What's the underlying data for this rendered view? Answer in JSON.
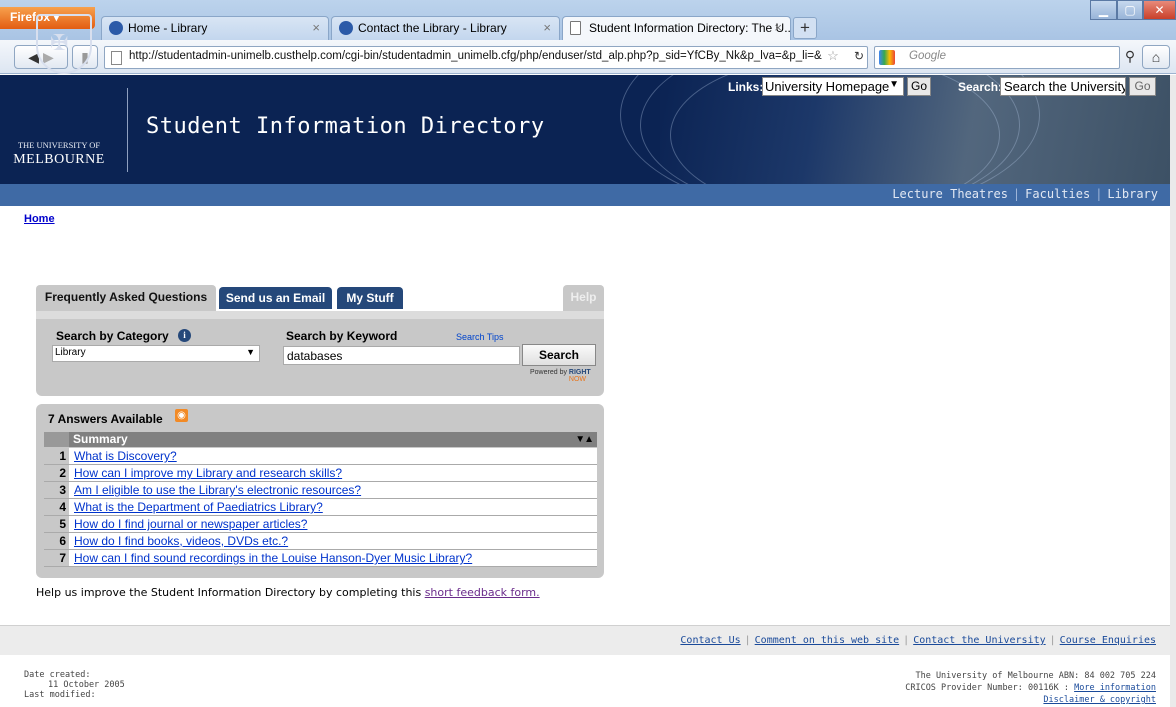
{
  "browser": {
    "menu_button": "Firefox",
    "tabs": [
      {
        "label": "Home - Library"
      },
      {
        "label": "Contact the Library - Library"
      },
      {
        "label": "Student Information Directory: The U..."
      }
    ],
    "new_tab": "+",
    "url": "http://studentadmin-unimelb.custhelp.com/cgi-bin/studentadmin_unimelb.cfg/php/enduser/std_alp.php?p_sid=YfCBy_Nk&p_lva=&p_li=&",
    "search_engine_placeholder": "Google",
    "icons": [
      "back-icon",
      "forward-icon",
      "reload-icon",
      "home-icon",
      "bookmark-star-icon",
      "search-icon"
    ]
  },
  "header": {
    "uni_small": "THE UNIVERSITY OF",
    "uni_big": "MELBOURNE",
    "site_title": "Student Information Directory",
    "links_label": "Links:",
    "links_selected": "University Homepage",
    "links_go": "Go",
    "search_label": "Search:",
    "search_value": "Search the University",
    "search_go": "Go"
  },
  "subnav": {
    "items": [
      "Lecture Theatres",
      "Faculties",
      "Library"
    ]
  },
  "breadcrumb": {
    "home": "Home"
  },
  "tabs": {
    "faq": "Frequently Asked Questions",
    "email": "Send us an Email",
    "stuff": "My Stuff",
    "help": "Help"
  },
  "search": {
    "category_label": "Search by Category",
    "category_value": "Library",
    "keyword_label": "Search by Keyword",
    "tips": "Search Tips",
    "keyword_value": "databases",
    "button": "Search",
    "powered_by": "Powered by",
    "powered_brand_1": "RIGHT",
    "powered_brand_2": "NOW"
  },
  "answers": {
    "title": "7 Answers Available",
    "summary_header": "Summary",
    "rows": [
      {
        "num": "1",
        "q": "What is Discovery?"
      },
      {
        "num": "2",
        "q": "How can I improve my Library and research skills?"
      },
      {
        "num": "3",
        "q": "Am I eligible to use the Library's electronic resources?"
      },
      {
        "num": "4",
        "q": "What is the Department of Paediatrics Library?"
      },
      {
        "num": "5",
        "q": "How do I find journal or newspaper articles?"
      },
      {
        "num": "6",
        "q": "How do I find books, videos, DVDs etc.?"
      },
      {
        "num": "7",
        "q": "How can I find sound recordings in the Louise Hanson-Dyer Music Library?"
      }
    ]
  },
  "feedback": {
    "text": "Help us improve the Student Information Directory by completing this ",
    "link": "short feedback form."
  },
  "footer": {
    "links": [
      "Contact Us",
      "Comment on this web site",
      "Contact the University",
      "Course Enquiries"
    ],
    "date_created_label": "Date created:",
    "date_created": "11 October 2005",
    "last_modified_label": "Last modified:",
    "abn": "The University of Melbourne ABN: 84 002 705 224",
    "cricos": "CRICOS Provider Number: 00116K",
    "more_info": "More information",
    "disclaimer": "Disclaimer & copyright"
  },
  "colors": {
    "header_bg": "#0b2353",
    "subnav_bg": "#3f6aa5",
    "tab_dark": "#25487a",
    "panel_gray": "#c8c8c8"
  }
}
